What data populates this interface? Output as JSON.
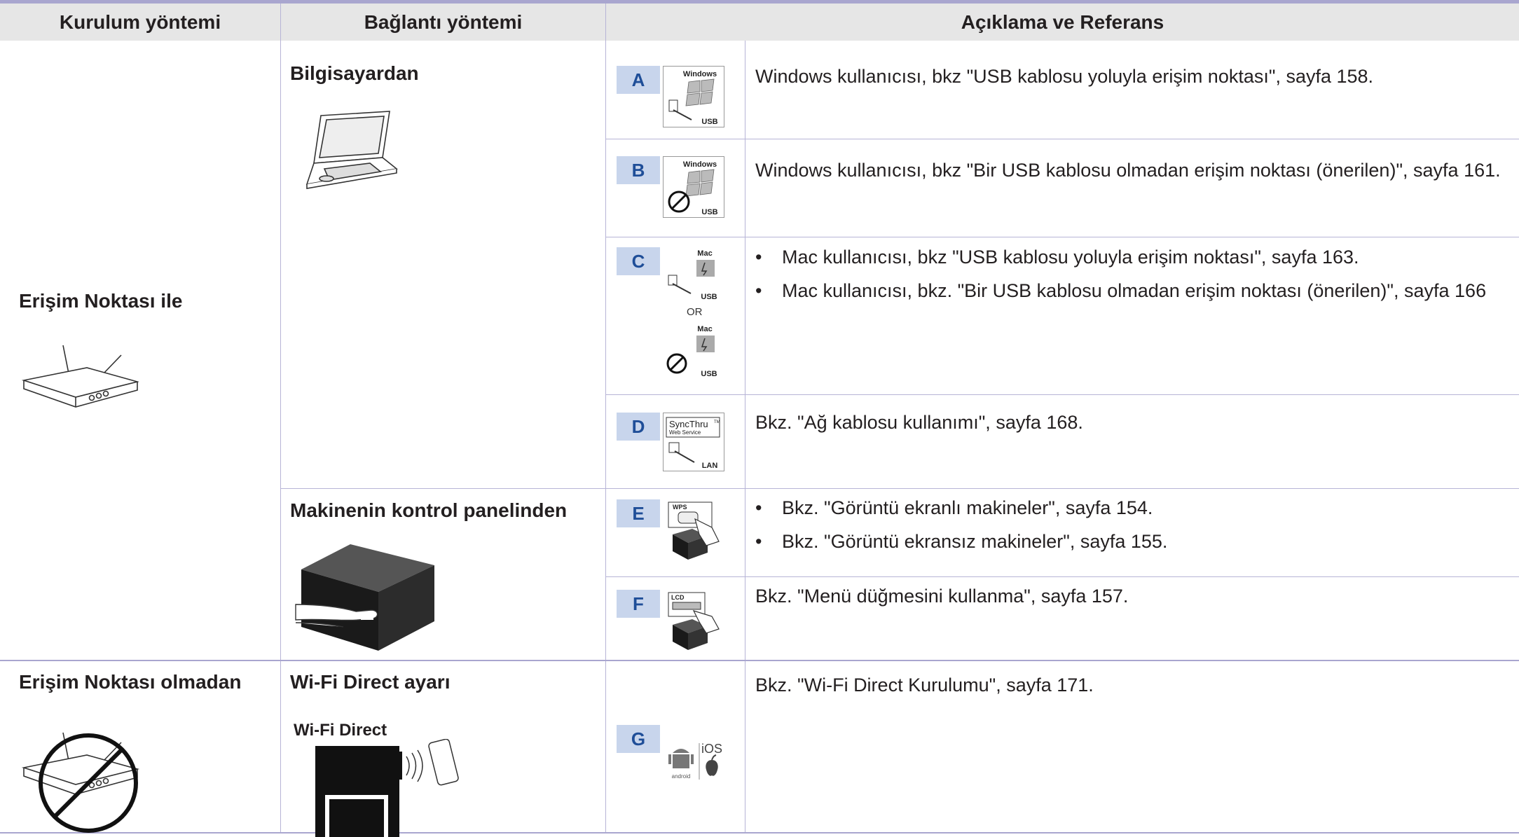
{
  "header": {
    "col1": "Kurulum yöntemi",
    "col2": "Bağlantı yöntemi",
    "col3": "Açıklama ve Referans"
  },
  "setup": {
    "ap": "Erişim Noktası ile",
    "no_ap": "Erişim Noktası olmadan"
  },
  "connections": {
    "computer": "Bilgisayardan",
    "panel": "Makinenin kontrol panelinden",
    "wifi": "Wi-Fi Direct ayarı"
  },
  "icons": {
    "windows": "Windows",
    "usb": "USB",
    "mac": "Mac",
    "or": "OR",
    "syncthru": "SyncThru",
    "web_service": "Web Service",
    "lan": "LAN",
    "wps": "WPS",
    "lcd": "LCD",
    "wifi_direct": "Wi-Fi Direct",
    "ios": "iOS",
    "android": "android",
    "tm": "TM"
  },
  "rows": [
    {
      "label": "A",
      "text": "Windows kullanıcısı, bkz \"USB kablosu yoluyla erişim noktası\", sayfa 158."
    },
    {
      "label": "B",
      "text": "Windows kullanıcısı, bkz \"Bir USB kablosu olmadan erişim noktası (önerilen)\", sayfa 161."
    },
    {
      "label": "C",
      "bullets": [
        "Mac kullanıcısı, bkz \"USB kablosu yoluyla erişim noktası\", sayfa 163.",
        "Mac kullanıcısı, bkz. \"Bir USB kablosu olmadan erişim noktası (önerilen)\", sayfa 166"
      ]
    },
    {
      "label": "D",
      "text": "Bkz. \"Ağ kablosu kullanımı\", sayfa 168."
    },
    {
      "label": "E",
      "bullets": [
        "Bkz. \"Görüntü ekranlı makineler\", sayfa 154.",
        "Bkz. \"Görüntü ekransız makineler\", sayfa 155."
      ]
    },
    {
      "label": "F",
      "text": "Bkz. \"Menü düğmesini kullanma\", sayfa 157."
    },
    {
      "label": "G",
      "text": "Bkz. \"Wi-Fi Direct Kurulumu\", sayfa 171."
    }
  ],
  "colors": {
    "header_bg": "#e6e6e6",
    "badge_bg": "#c8d5ec",
    "badge_text": "#1f4e98",
    "rule": "#b7b4d6"
  }
}
